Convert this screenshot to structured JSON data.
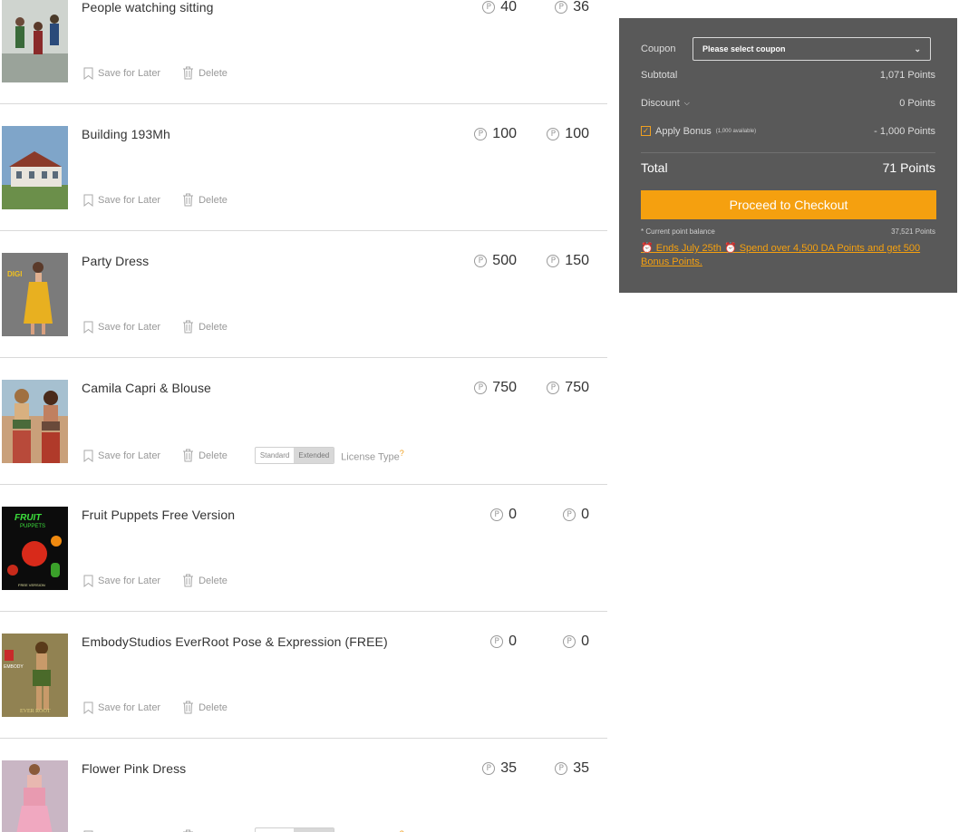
{
  "cart": {
    "save_label": "Save for Later",
    "delete_label": "Delete",
    "point_symbol": "P",
    "license_options": [
      "Standard",
      "Extended"
    ],
    "license_label": "License Type",
    "license_help": "?",
    "items": [
      {
        "name": "People watching sitting",
        "price_original": "40",
        "price_sale": "36",
        "license": false,
        "thumb": "crowd"
      },
      {
        "name": "Building 193Mh",
        "price_original": "100",
        "price_sale": "100",
        "license": false,
        "thumb": "building"
      },
      {
        "name": "Party Dress",
        "price_original": "500",
        "price_sale": "150",
        "license": false,
        "thumb": "dress-yellow"
      },
      {
        "name": "Camila Capri & Blouse",
        "price_original": "750",
        "price_sale": "750",
        "license": true,
        "thumb": "blouse"
      },
      {
        "name": "Fruit Puppets Free Version",
        "price_original": "0",
        "price_sale": "0",
        "license": false,
        "thumb": "fruit"
      },
      {
        "name": "EmbodyStudios EverRoot Pose & Expression (FREE)",
        "price_original": "0",
        "price_sale": "0",
        "license": false,
        "thumb": "embody"
      },
      {
        "name": "Flower Pink Dress",
        "price_original": "35",
        "price_sale": "35",
        "license": true,
        "thumb": "pink-dress"
      }
    ]
  },
  "summary": {
    "coupon_label": "Coupon",
    "coupon_placeholder": "Please select coupon",
    "subtotal_label": "Subtotal",
    "subtotal_value": "1,071 Points",
    "discount_label": "Discount",
    "discount_value": "0 Points",
    "bonus_label": "Apply Bonus",
    "bonus_available": "(1,000 available)",
    "bonus_value": "- 1,000 Points",
    "total_label": "Total",
    "total_value": "71 Points",
    "checkout_label": "Proceed to Checkout",
    "balance_label": "* Current point balance",
    "balance_value": "37,521 Points",
    "promo_text": "⏰ Ends July 25th ⏰ Spend over 4,500 DA Points and get 500 Bonus Points.",
    "accent_color": "#f5a00f",
    "panel_color": "#595959"
  }
}
